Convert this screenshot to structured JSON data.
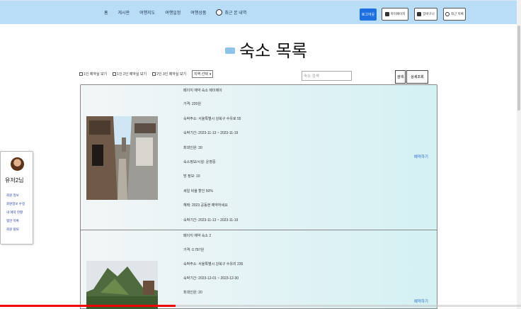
{
  "nav": {
    "items": [
      "홈",
      "게시판",
      "여행지도",
      "여행일정",
      "여행상품"
    ],
    "recent_label": "최근 본 내역"
  },
  "topbar_buttons": {
    "primary": "로그아웃",
    "my_info": "마이페이지",
    "cart": "장바구니",
    "recent": "최근 목록"
  },
  "page": {
    "title": "숙소 목록"
  },
  "filters": {
    "options": [
      "1인 예약실 보기",
      "1인 2인 예약실 보기",
      "2인 3인 예약실 보기"
    ],
    "sort_select": "지역 선택"
  },
  "search": {
    "placeholder": "숙소 검색",
    "search_button": "검색",
    "detail_button": "상세조회"
  },
  "listings": [
    {
      "name": "페이지 예약 숙소 제이제이",
      "price": "가격: 220원",
      "address": "숙박주소: 서울특별시 강북구 수유로 55",
      "period": "숙박기간: 2023-11-13 ~ 2023-11-19",
      "capacity": "최대인원: 30",
      "facility": "숙소정보/시설: 운영중",
      "room": "방 정보: 10",
      "discount": "세일 비율 할인 50%",
      "note": "혜택: 2023 공동현 예약하세요",
      "date_range": "숙박기간: 2023-11-13 ~ 2023-11-19",
      "reserve_label": "예약하기"
    },
    {
      "name": "페이지 예약 숙소 2",
      "price": "가격: 0.787원",
      "address": "숙박주소: 서울특별시 강북구 수유리 235",
      "period": "숙박기간: 2023-12-01 ~ 2023-12-30",
      "capacity": "최대인원: 20",
      "reserve_label": "예약하기"
    }
  ],
  "sidebar": {
    "user": "유저2님",
    "links": [
      "회원 정보",
      "회원정보 수정",
      "내 예약 현황",
      "찜한 목록",
      "회원 탈퇴"
    ]
  },
  "video_progress": 0.337
}
